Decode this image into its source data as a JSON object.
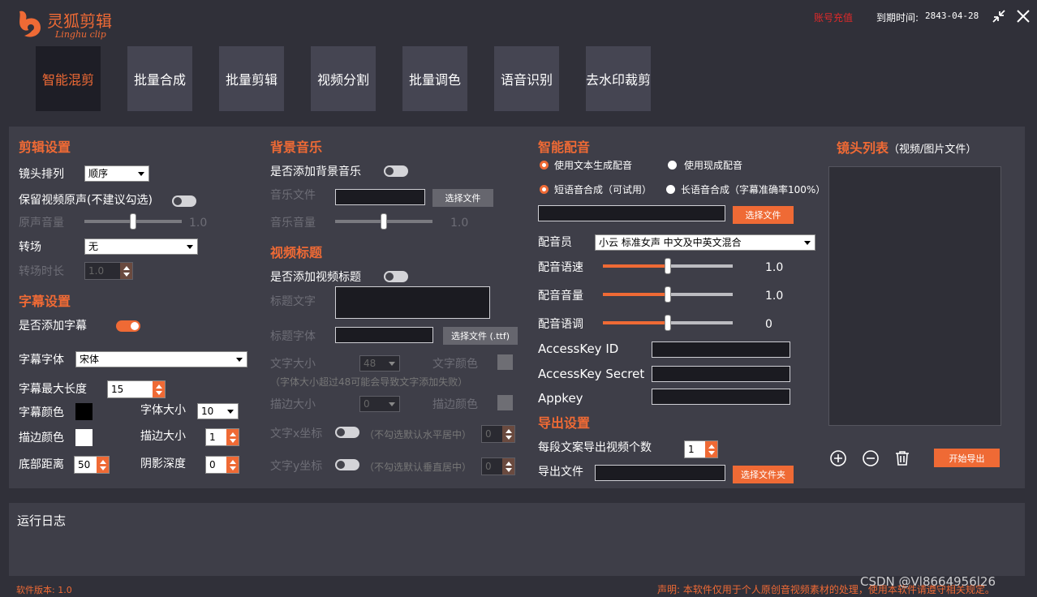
{
  "header": {
    "logo_text": "灵狐剪辑",
    "logo_sub": "Linghu clip",
    "recharge_link": "账号充值",
    "expiry_label": "到期时间:",
    "expiry_value": "2843-04-28",
    "icons": [
      "collapse-icon",
      "close-icon"
    ]
  },
  "tabs": [
    {
      "label": "智能混剪",
      "active": true
    },
    {
      "label": "批量合成",
      "active": false
    },
    {
      "label": "批量剪辑",
      "active": false
    },
    {
      "label": "视频分割",
      "active": false
    },
    {
      "label": "批量调色",
      "active": false
    },
    {
      "label": "语音识别",
      "active": false
    },
    {
      "label": "去水印裁剪",
      "active": false
    }
  ],
  "edit": {
    "title": "剪辑设置",
    "shot_order_label": "镜头排列",
    "shot_order_value": "顺序",
    "keep_audio_label": "保留视频原声(不建议勾选)",
    "orig_volume_label": "原声音量",
    "orig_volume_value": "1.0",
    "orig_volume_level": 0.5,
    "transition_label": "转场",
    "transition_value": "无",
    "transition_dur_label": "转场时长",
    "transition_dur_value": "1.0"
  },
  "subtitle": {
    "title": "字幕设置",
    "add_label": "是否添加字幕",
    "font_label": "字幕字体",
    "font_value": "宋体",
    "maxlen_label": "字幕最大长度",
    "maxlen_value": "15",
    "color_label": "字幕颜色",
    "color_value": "#000000",
    "fontsize_label": "字体大小",
    "fontsize_value": "10",
    "stroke_color_label": "描边颜色",
    "stroke_color_value": "#ffffff",
    "stroke_size_label": "描边大小",
    "stroke_size_value": "1",
    "bottom_label": "底部距离",
    "bottom_value": "50",
    "shadow_label": "阴影深度",
    "shadow_value": "0"
  },
  "music": {
    "title": "背景音乐",
    "add_label": "是否添加背景音乐",
    "file_label": "音乐文件",
    "file_value": "",
    "select_btn": "选择文件",
    "volume_label": "音乐音量",
    "volume_value": "1.0",
    "volume_level": 0.5
  },
  "vtitle": {
    "title": "视频标题",
    "add_label": "是否添加视频标题",
    "text_label": "标题文字",
    "text_value": "",
    "font_label": "标题字体",
    "font_value": "",
    "font_btn": "选择文件 (.ttf)",
    "size_label": "文字大小",
    "size_value": "48",
    "color_label": "文字颜色",
    "note": "（字体大小超过48可能会导致文字添加失败）",
    "stroke_label": "描边大小",
    "stroke_value": "0",
    "stroke_color_label": "描边颜色",
    "x_label": "文字x坐标",
    "x_note": "（不勾选默认水平居中）",
    "x_value": "0",
    "y_label": "文字y坐标",
    "y_note": "（不勾选默认垂直居中）",
    "y_value": "0"
  },
  "dub": {
    "title": "智能配音",
    "radio1": "使用文本生成配音",
    "radio2": "使用现成配音",
    "radio3": "短语音合成（可试用）",
    "radio4": "长语音合成（字幕准确率100%）",
    "file_value": "",
    "select_btn": "选择文件",
    "voice_label": "配音员",
    "voice_value": "小云  标准女声  中文及中英文混合",
    "speed_label": "配音语速",
    "speed_value": "1.0",
    "speed_level": 0.5,
    "volume_label": "配音音量",
    "volume_value": "1.0",
    "volume_level": 0.5,
    "pitch_label": "配音语调",
    "pitch_value": "0",
    "pitch_level": 0.5,
    "ak_id_label": "AccessKey ID",
    "ak_secret_label": "AccessKey Secret",
    "appkey_label": "Appkey"
  },
  "export": {
    "title": "导出设置",
    "count_label": "每段文案导出视频个数",
    "count_value": "1",
    "file_label": "导出文件",
    "file_value": "",
    "folder_btn": "选择文件夹"
  },
  "shots": {
    "title": "镜头列表",
    "subtitle": "（视频/图片文件）",
    "export_btn": "开始导出",
    "icons": [
      "add-circle-icon",
      "remove-circle-icon",
      "trash-icon"
    ]
  },
  "log": {
    "title": "运行日志"
  },
  "footer": {
    "version": "软件版本: 1.0",
    "disclaimer": "声明: 本软件仅用于个人原创音视频素材的处理，使用本软件请遵守相关规定。",
    "watermark": "CSDN @Vl8664956l26"
  },
  "colors": {
    "accent": "#ef6a35",
    "bg": "#303039",
    "panel": "#3e3e48"
  }
}
